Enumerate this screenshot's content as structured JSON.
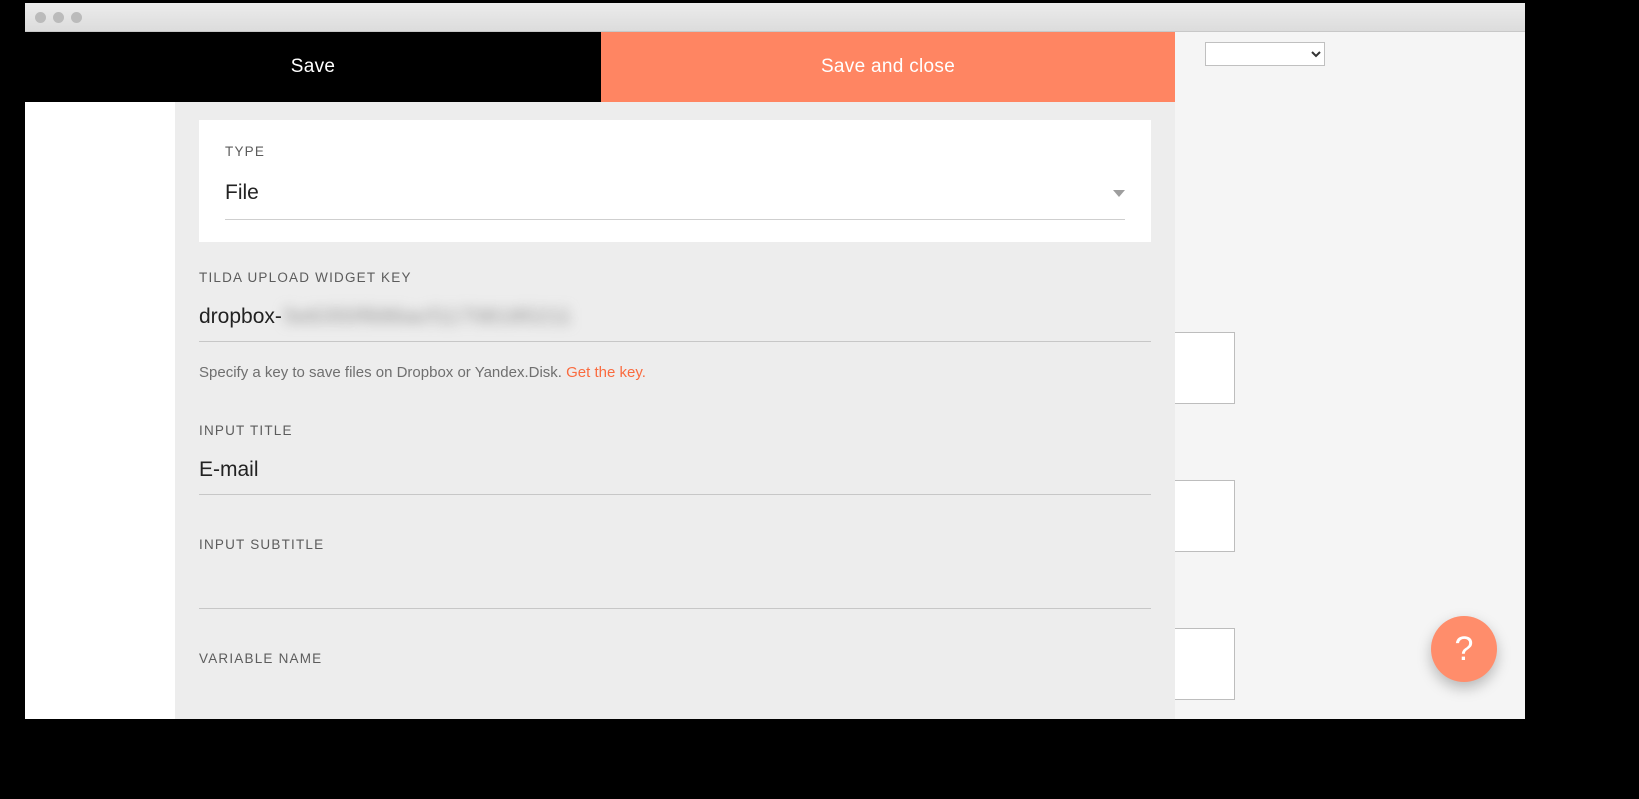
{
  "header": {
    "save_label": "Save",
    "save_close_label": "Save and close"
  },
  "form": {
    "type": {
      "label": "TYPE",
      "value": "File"
    },
    "widget_key": {
      "label": "TILDA UPLOAD WIDGET KEY",
      "prefix": "dropbox-",
      "obscured": "5e6350f686acf11708185211",
      "hint_text": "Specify a key to save files on Dropbox or Yandex.Disk. ",
      "hint_link": "Get the key."
    },
    "input_title": {
      "label": "INPUT TITLE",
      "value": "E-mail"
    },
    "input_subtitle": {
      "label": "INPUT SUBTITLE",
      "value": ""
    },
    "variable_name": {
      "label": "VARIABLE NAME"
    }
  },
  "help": {
    "glyph": "?"
  }
}
